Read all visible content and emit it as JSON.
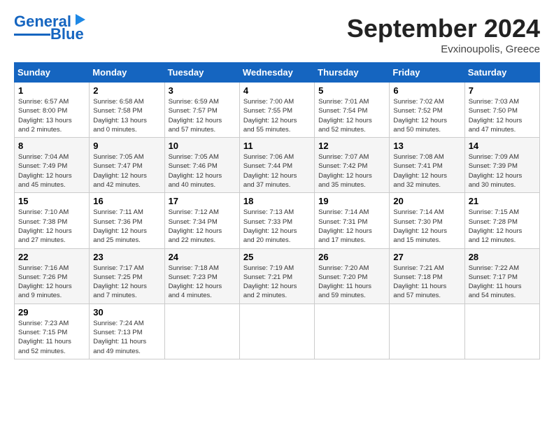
{
  "header": {
    "logo": {
      "part1": "General",
      "part2": "Blue"
    },
    "month": "September 2024",
    "location": "Evxinoupolis, Greece"
  },
  "weekdays": [
    "Sunday",
    "Monday",
    "Tuesday",
    "Wednesday",
    "Thursday",
    "Friday",
    "Saturday"
  ],
  "weeks": [
    [
      {
        "day": "1",
        "sunrise": "6:57 AM",
        "sunset": "8:00 PM",
        "daylight": "13 hours and 2 minutes."
      },
      {
        "day": "2",
        "sunrise": "6:58 AM",
        "sunset": "7:58 PM",
        "daylight": "13 hours and 0 minutes."
      },
      {
        "day": "3",
        "sunrise": "6:59 AM",
        "sunset": "7:57 PM",
        "daylight": "12 hours and 57 minutes."
      },
      {
        "day": "4",
        "sunrise": "7:00 AM",
        "sunset": "7:55 PM",
        "daylight": "12 hours and 55 minutes."
      },
      {
        "day": "5",
        "sunrise": "7:01 AM",
        "sunset": "7:54 PM",
        "daylight": "12 hours and 52 minutes."
      },
      {
        "day": "6",
        "sunrise": "7:02 AM",
        "sunset": "7:52 PM",
        "daylight": "12 hours and 50 minutes."
      },
      {
        "day": "7",
        "sunrise": "7:03 AM",
        "sunset": "7:50 PM",
        "daylight": "12 hours and 47 minutes."
      }
    ],
    [
      {
        "day": "8",
        "sunrise": "7:04 AM",
        "sunset": "7:49 PM",
        "daylight": "12 hours and 45 minutes."
      },
      {
        "day": "9",
        "sunrise": "7:05 AM",
        "sunset": "7:47 PM",
        "daylight": "12 hours and 42 minutes."
      },
      {
        "day": "10",
        "sunrise": "7:05 AM",
        "sunset": "7:46 PM",
        "daylight": "12 hours and 40 minutes."
      },
      {
        "day": "11",
        "sunrise": "7:06 AM",
        "sunset": "7:44 PM",
        "daylight": "12 hours and 37 minutes."
      },
      {
        "day": "12",
        "sunrise": "7:07 AM",
        "sunset": "7:42 PM",
        "daylight": "12 hours and 35 minutes."
      },
      {
        "day": "13",
        "sunrise": "7:08 AM",
        "sunset": "7:41 PM",
        "daylight": "12 hours and 32 minutes."
      },
      {
        "day": "14",
        "sunrise": "7:09 AM",
        "sunset": "7:39 PM",
        "daylight": "12 hours and 30 minutes."
      }
    ],
    [
      {
        "day": "15",
        "sunrise": "7:10 AM",
        "sunset": "7:38 PM",
        "daylight": "12 hours and 27 minutes."
      },
      {
        "day": "16",
        "sunrise": "7:11 AM",
        "sunset": "7:36 PM",
        "daylight": "12 hours and 25 minutes."
      },
      {
        "day": "17",
        "sunrise": "7:12 AM",
        "sunset": "7:34 PM",
        "daylight": "12 hours and 22 minutes."
      },
      {
        "day": "18",
        "sunrise": "7:13 AM",
        "sunset": "7:33 PM",
        "daylight": "12 hours and 20 minutes."
      },
      {
        "day": "19",
        "sunrise": "7:14 AM",
        "sunset": "7:31 PM",
        "daylight": "12 hours and 17 minutes."
      },
      {
        "day": "20",
        "sunrise": "7:14 AM",
        "sunset": "7:30 PM",
        "daylight": "12 hours and 15 minutes."
      },
      {
        "day": "21",
        "sunrise": "7:15 AM",
        "sunset": "7:28 PM",
        "daylight": "12 hours and 12 minutes."
      }
    ],
    [
      {
        "day": "22",
        "sunrise": "7:16 AM",
        "sunset": "7:26 PM",
        "daylight": "12 hours and 9 minutes."
      },
      {
        "day": "23",
        "sunrise": "7:17 AM",
        "sunset": "7:25 PM",
        "daylight": "12 hours and 7 minutes."
      },
      {
        "day": "24",
        "sunrise": "7:18 AM",
        "sunset": "7:23 PM",
        "daylight": "12 hours and 4 minutes."
      },
      {
        "day": "25",
        "sunrise": "7:19 AM",
        "sunset": "7:21 PM",
        "daylight": "12 hours and 2 minutes."
      },
      {
        "day": "26",
        "sunrise": "7:20 AM",
        "sunset": "7:20 PM",
        "daylight": "11 hours and 59 minutes."
      },
      {
        "day": "27",
        "sunrise": "7:21 AM",
        "sunset": "7:18 PM",
        "daylight": "11 hours and 57 minutes."
      },
      {
        "day": "28",
        "sunrise": "7:22 AM",
        "sunset": "7:17 PM",
        "daylight": "11 hours and 54 minutes."
      }
    ],
    [
      {
        "day": "29",
        "sunrise": "7:23 AM",
        "sunset": "7:15 PM",
        "daylight": "11 hours and 52 minutes."
      },
      {
        "day": "30",
        "sunrise": "7:24 AM",
        "sunset": "7:13 PM",
        "daylight": "11 hours and 49 minutes."
      },
      null,
      null,
      null,
      null,
      null
    ]
  ]
}
